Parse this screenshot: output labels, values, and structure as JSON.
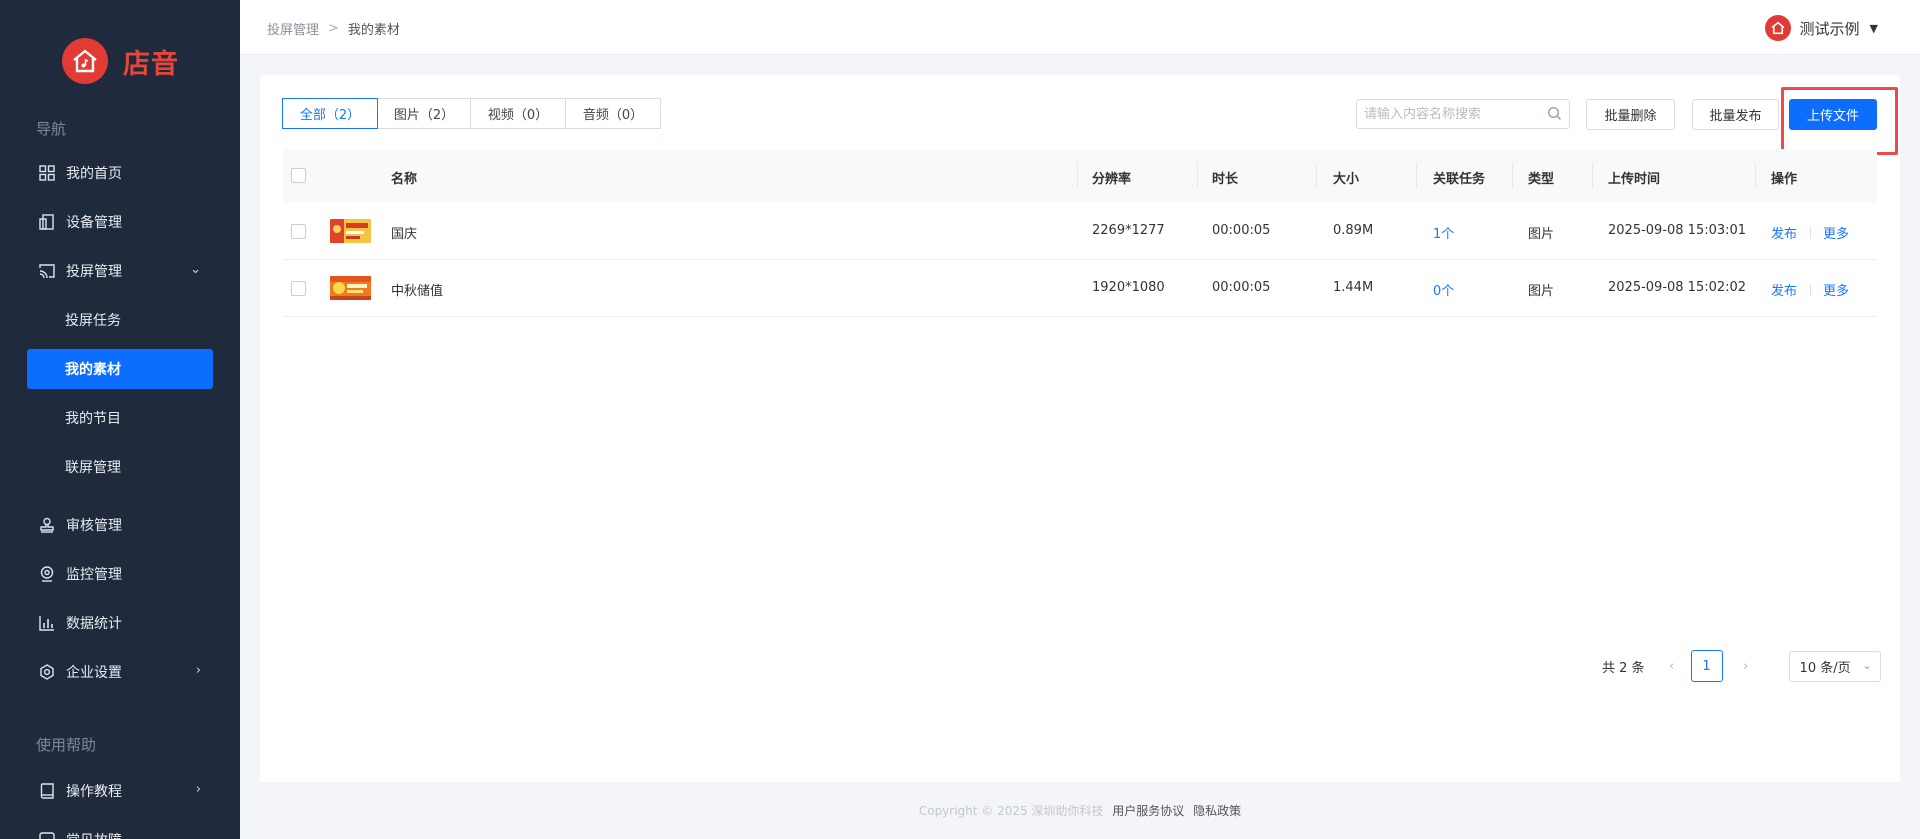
{
  "brand": {
    "name": "店音",
    "color": "#e23b35",
    "accent": "#0d6efd"
  },
  "sidebar": {
    "section_nav": "导航",
    "section_help": "使用帮助",
    "items": [
      {
        "label": "我的首页",
        "icon": "grid-icon"
      },
      {
        "label": "设备管理",
        "icon": "device-icon"
      },
      {
        "label": "投屏管理",
        "icon": "cast-icon"
      },
      {
        "label": "审核管理",
        "icon": "stamp-icon"
      },
      {
        "label": "监控管理",
        "icon": "camera-icon"
      },
      {
        "label": "数据统计",
        "icon": "bar-chart-icon"
      },
      {
        "label": "企业设置",
        "icon": "gear-icon"
      }
    ],
    "subitems": [
      "投屏任务",
      "我的素材",
      "我的节目",
      "联屏管理"
    ],
    "help_items": [
      {
        "label": "操作教程",
        "icon": "book-icon"
      },
      {
        "label": "常见故障",
        "icon": "help-icon"
      }
    ]
  },
  "header": {
    "breadcrumb": [
      "投屏管理",
      "我的素材"
    ],
    "breadcrumb_sep": ">",
    "user": "测试示例"
  },
  "toolbar": {
    "tabs": [
      "全部（2）",
      "图片（2）",
      "视频（0）",
      "音频（0）"
    ],
    "search_placeholder": "请输入内容名称搜索",
    "batch_delete": "批量删除",
    "batch_publish": "批量发布",
    "upload": "上传文件"
  },
  "table": {
    "headers": [
      "名称",
      "分辨率",
      "时长",
      "大小",
      "关联任务",
      "类型",
      "上传时间",
      "操作"
    ],
    "rows": [
      {
        "name": "国庆",
        "resolution": "2269*1277",
        "duration": "00:00:05",
        "size": "0.89M",
        "tasks": "1个",
        "type": "图片",
        "uploaded": "2025-09-08 15:03:01",
        "op1": "发布",
        "op2": "更多"
      },
      {
        "name": "中秋储值",
        "resolution": "1920*1080",
        "duration": "00:00:05",
        "size": "1.44M",
        "tasks": "0个",
        "type": "图片",
        "uploaded": "2025-09-08 15:02:02",
        "op1": "发布",
        "op2": "更多"
      }
    ]
  },
  "pagination": {
    "total": "共 2 条",
    "current": "1",
    "page_size": "10 条/页"
  },
  "footer": {
    "copyright": "Copyright © 2025 深圳助你科技",
    "terms": "用户服务协议",
    "privacy": "隐私政策"
  }
}
